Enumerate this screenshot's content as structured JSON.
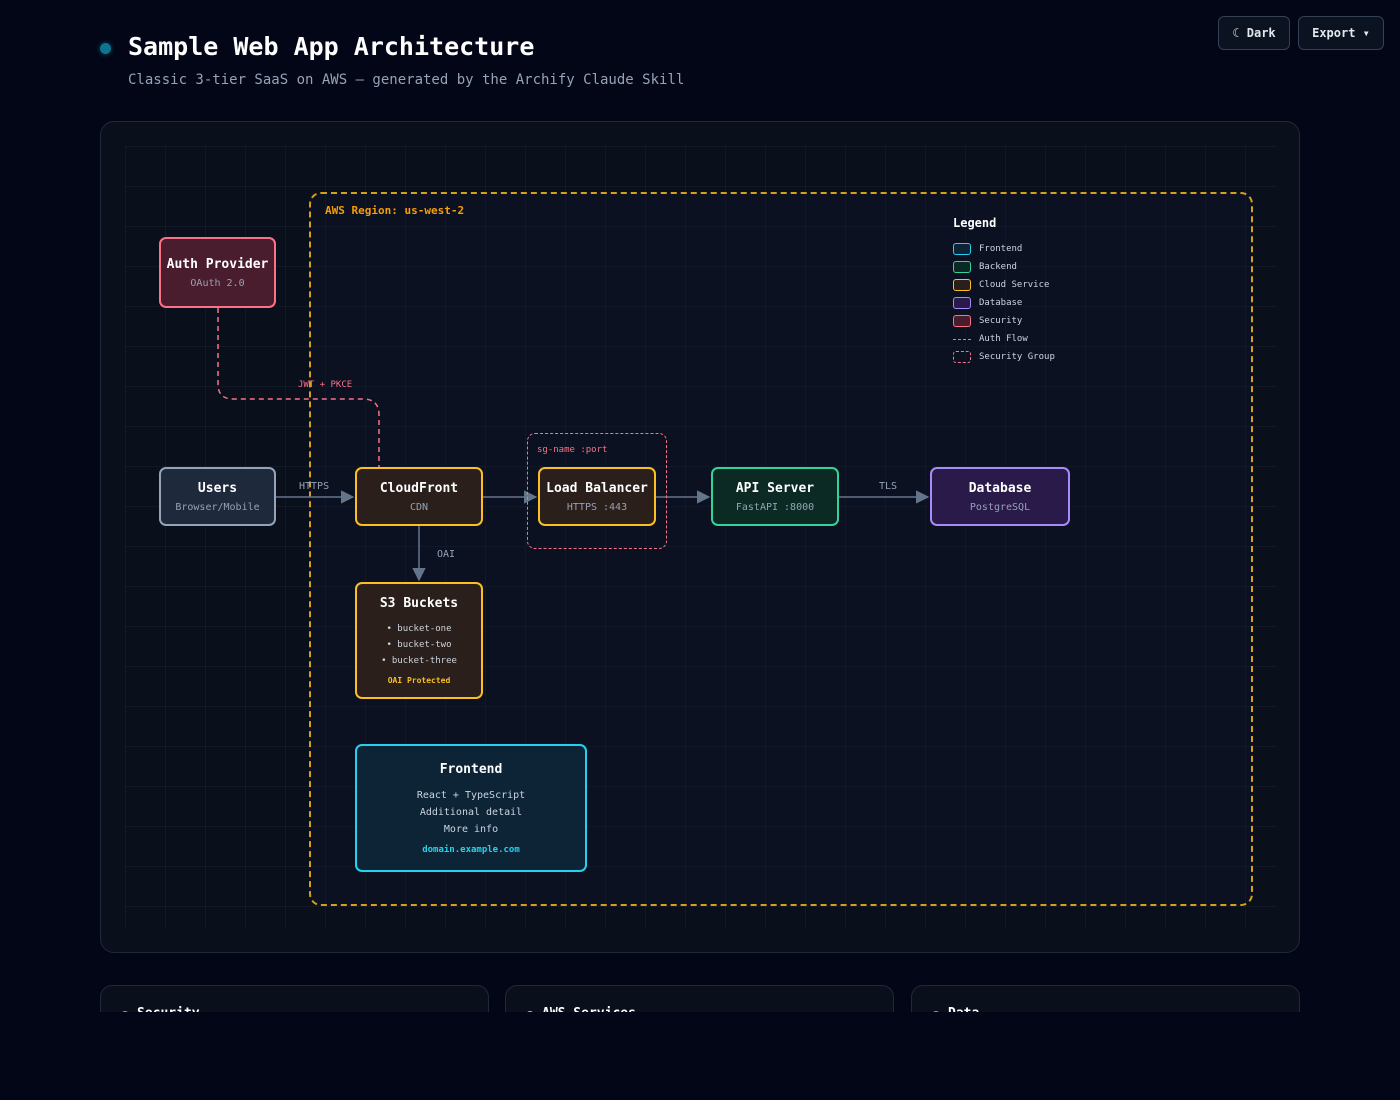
{
  "header": {
    "title": "Sample Web App Architecture",
    "subtitle": "Classic 3-tier SaaS on AWS — generated by the Archify Claude Skill",
    "theme_button": "☾ Dark",
    "export_button": "Export ▾"
  },
  "region": {
    "label": "AWS Region: us-west-2"
  },
  "nodes": {
    "users": {
      "title": "Users",
      "subtitle": "Browser/Mobile"
    },
    "auth": {
      "title": "Auth Provider",
      "subtitle": "OAuth 2.0"
    },
    "cloudfront": {
      "title": "CloudFront",
      "subtitle": "CDN"
    },
    "load_balancer": {
      "title": "Load Balancer",
      "subtitle": "HTTPS :443"
    },
    "api_server": {
      "title": "API Server",
      "subtitle": "FastAPI :8000"
    },
    "database": {
      "title": "Database",
      "subtitle": "PostgreSQL"
    },
    "s3": {
      "title": "S3 Buckets",
      "items": [
        "• bucket-one",
        "• bucket-two",
        "• bucket-three"
      ],
      "note": "OAI Protected"
    },
    "frontend": {
      "title": "Frontend",
      "lines": [
        "React + TypeScript",
        "Additional detail",
        "More info"
      ],
      "domain": "domain.example.com"
    }
  },
  "security_group": {
    "label": "sg-name :port"
  },
  "edges": {
    "users_cloudfront": "HTTPS",
    "auth_flow": "JWT + PKCE",
    "cloudfront_s3": "OAI",
    "api_database": "TLS"
  },
  "legend": {
    "title": "Legend",
    "items": [
      {
        "label": "Frontend",
        "color": "#22d3ee"
      },
      {
        "label": "Backend",
        "color": "#34d399"
      },
      {
        "label": "Cloud Service",
        "color": "#fbbf24"
      },
      {
        "label": "Database",
        "color": "#a78bfa"
      },
      {
        "label": "Security",
        "color": "#fb7185"
      }
    ],
    "auth_flow": "Auth Flow",
    "security_group": "Security Group"
  },
  "panels": [
    {
      "title": "Security",
      "color": "#fb7185"
    },
    {
      "title": "AWS Services",
      "color": "#fbbf24"
    },
    {
      "title": "Data",
      "color": "#a78bfa"
    }
  ],
  "colors": {
    "background": "#020617",
    "frontend": "#22d3ee",
    "backend": "#34d399",
    "cloud_service": "#fbbf24",
    "database": "#a78bfa",
    "security": "#fb7185",
    "region": "#d4a017"
  }
}
